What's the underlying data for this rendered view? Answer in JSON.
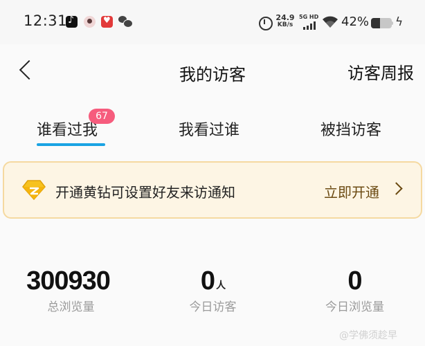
{
  "status_bar": {
    "time": "12:31",
    "net_speed": "24.9",
    "net_speed_unit": "KB/s",
    "network_type": "5G HD",
    "battery_percent": "42%",
    "battery_level": 0.42,
    "app_icons": [
      "tiktok-icon",
      "avatar-icon",
      "red-app-icon",
      "wechat-icon"
    ],
    "system_icons": [
      "alarm-icon",
      "signal-icon",
      "wifi-icon",
      "battery-icon",
      "charging-icon"
    ]
  },
  "nav": {
    "back_icon": "chevron-left-icon",
    "title": "我的访客",
    "right_label": "访客周报"
  },
  "tabs": [
    {
      "label": "谁看过我",
      "active": true,
      "badge": "67"
    },
    {
      "label": "我看过谁",
      "active": false
    },
    {
      "label": "被挡访客",
      "active": false
    }
  ],
  "promo": {
    "icon": "yellow-diamond-icon",
    "text": "开通黄钻可设置好友来访通知",
    "action": "立即开通"
  },
  "stats": [
    {
      "value": "300930",
      "unit": "",
      "label": "总浏览量"
    },
    {
      "value": "0",
      "unit": "人",
      "label": "今日访客"
    },
    {
      "value": "0",
      "unit": "",
      "label": "今日浏览量"
    }
  ],
  "watermark": "@学佛须趁早",
  "colors": {
    "accent": "#1aa3e3",
    "badge": "#f65c7d",
    "promo_bg": "#fdf5e4",
    "promo_border": "#f5d9a0",
    "promo_action": "#6b4a12"
  }
}
